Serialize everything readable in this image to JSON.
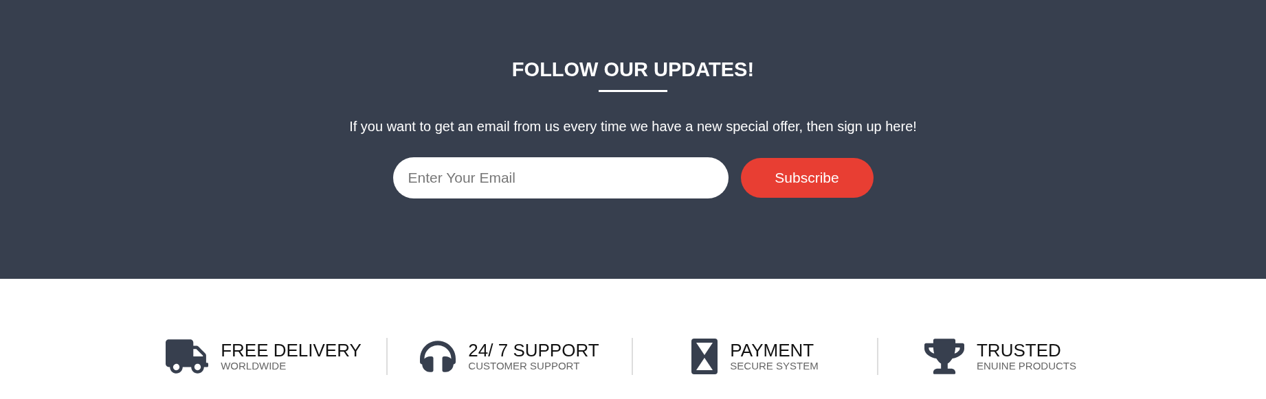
{
  "newsletter": {
    "title": "FOLLOW OUR UPDATES!",
    "text": "If you want to get an email from us every time we have a new special offer, then sign up here!",
    "email_field": {
      "placeholder": "Enter Your Email"
    },
    "button": "Subscribe"
  },
  "features": [
    {
      "kind": "truck",
      "title": "FREE DELIVERY",
      "subtitle": "WORLDWIDE"
    },
    {
      "kind": "headphones",
      "title": "24/ 7 SUPPORT",
      "subtitle": "CUSTOMER SUPPORT"
    },
    {
      "kind": "hourglass",
      "title": "PAYMENT",
      "subtitle": "SECURE SYSTEM"
    },
    {
      "kind": "trophy",
      "title": "TRUSTED",
      "subtitle": "ENUINE PRODUCTS"
    }
  ]
}
